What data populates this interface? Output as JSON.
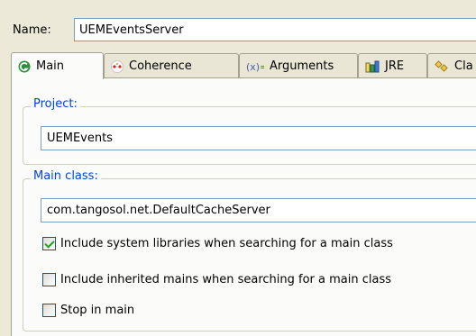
{
  "name_label": "Name:",
  "name_value": "UEMEventsServer",
  "tabs": [
    {
      "label": "Main",
      "icon": "main-green-circle-icon"
    },
    {
      "label": "Coherence",
      "icon": "coherence-dots-icon"
    },
    {
      "label": "Arguments",
      "icon": "arguments-x-icon"
    },
    {
      "label": "JRE",
      "icon": "jre-library-icon"
    },
    {
      "label": "Cla",
      "icon": "classpath-icon"
    }
  ],
  "project": {
    "title": "Project:",
    "value": "UEMEvents"
  },
  "main_class": {
    "title": "Main class:",
    "value": "com.tangosol.net.DefaultCacheServer"
  },
  "options": [
    {
      "label": "Include system libraries when searching for a main class",
      "checked": true
    },
    {
      "label": "Include inherited mains when searching for a main class",
      "checked": false
    },
    {
      "label": "Stop in main",
      "checked": false
    }
  ],
  "colors": {
    "accent": "#0046d5",
    "background": "#ece9d8",
    "panel": "#fbfbfa"
  }
}
